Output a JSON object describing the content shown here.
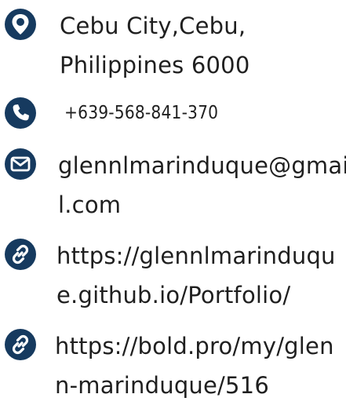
{
  "colors": {
    "icon_bg": "#163a5f",
    "icon_fg": "#ffffff",
    "text": "#1f1f1f"
  },
  "contacts": [
    {
      "icon": "map-pin-icon",
      "lines": [
        "Cebu City,Cebu,",
        "Philippines  6000"
      ]
    },
    {
      "icon": "phone-icon",
      "lines": [
        "+639-568-841-370"
      ]
    },
    {
      "icon": "envelope-icon",
      "lines": [
        "glennlmarinduque@gmai",
        "l.com"
      ]
    },
    {
      "icon": "link-icon",
      "lines": [
        "https://glennlmarinduqu",
        "e.github.io/Portfolio/"
      ]
    },
    {
      "icon": "link-icon",
      "lines": [
        "https://bold.pro/my/glen",
        "n-marinduque/516"
      ]
    }
  ]
}
